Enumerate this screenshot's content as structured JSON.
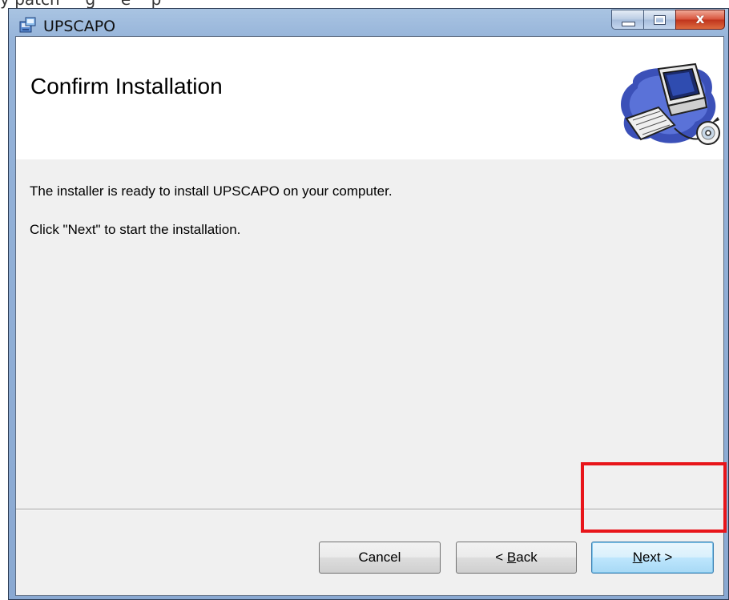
{
  "window": {
    "title": "UPSCAPO",
    "close_glyph": "x",
    "controls": [
      "minimize",
      "maximize",
      "close"
    ]
  },
  "banner": {
    "title": "Confirm Installation",
    "graphic_icon": "computer-setup-graphic"
  },
  "body": {
    "line1": "The installer is ready to install UPSCAPO on your computer.",
    "line2": "Click \"Next\" to start the installation."
  },
  "buttons": {
    "cancel": "Cancel",
    "back_prefix": "< ",
    "back_mnemonic": "B",
    "back_rest": "ack",
    "next_mnemonic": "N",
    "next_rest": "ext >"
  },
  "colors": {
    "highlight": "#e8151a",
    "dialog_bg": "#f0f0f0"
  }
}
